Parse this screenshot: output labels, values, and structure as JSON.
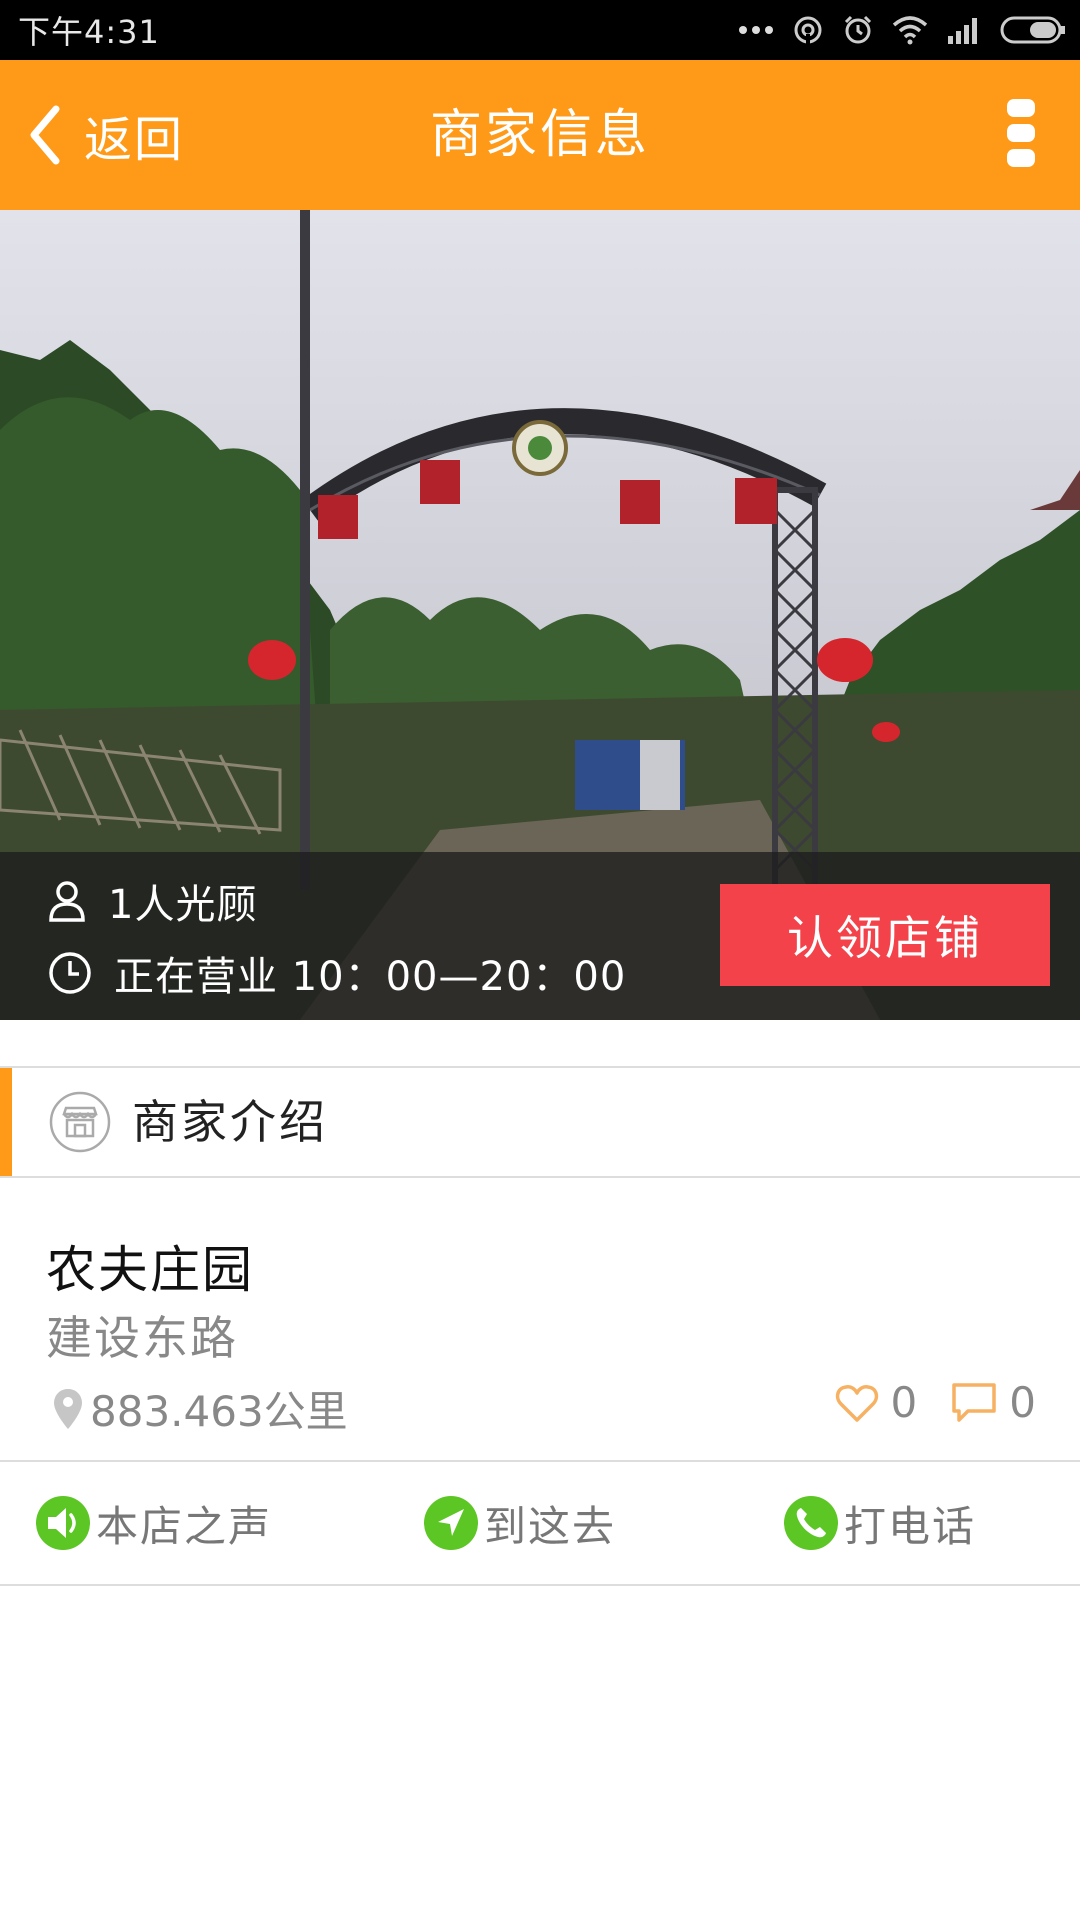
{
  "status_bar": {
    "time": "下午4:31",
    "icons": [
      "more-dots-icon",
      "hotspot-icon",
      "alarm-icon",
      "wifi-icon",
      "signal-icon",
      "battery-icon"
    ]
  },
  "header": {
    "back_label": "返回",
    "title": "商家信息",
    "background_color": "#ff9a19"
  },
  "hero": {
    "visitors": "1人光顾",
    "hours": "正在营业 10：00—20：00",
    "claim_label": "认领店铺",
    "claim_color": "#f4424a"
  },
  "section": {
    "title": "商家介绍"
  },
  "store": {
    "name": "农夫庄园",
    "street": "建设东路",
    "distance": "883.463公里",
    "likes": "0",
    "comments": "0"
  },
  "actions": {
    "voice": "本店之声",
    "navigate": "到这去",
    "call": "打电话",
    "icon_color": "#5cc624"
  }
}
